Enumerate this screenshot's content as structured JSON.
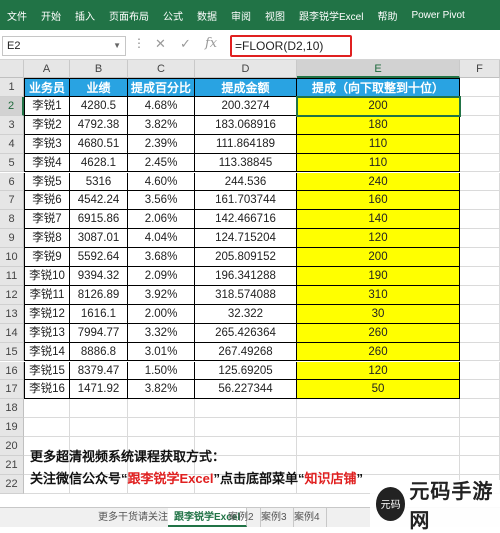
{
  "ribbon": {
    "tabs": [
      "文件",
      "开始",
      "插入",
      "页面布局",
      "公式",
      "数据",
      "审阅",
      "视图",
      "跟李锐学Excel",
      "帮助",
      "Power Pivot"
    ]
  },
  "formula_bar": {
    "name_box": "E2",
    "formula": "=FLOOR(D2,10)",
    "icons": {
      "more": "more-dots-icon",
      "cancel": "cancel-x-icon",
      "enter": "checkmark-icon",
      "fx": "fx-icon"
    }
  },
  "grid": {
    "columns": [
      "A",
      "B",
      "C",
      "D",
      "E",
      "F"
    ],
    "rows": [
      "1",
      "2",
      "3",
      "4",
      "5",
      "6",
      "7",
      "8",
      "9",
      "10",
      "11",
      "12",
      "13",
      "14",
      "15",
      "16",
      "17",
      "18",
      "19",
      "20",
      "21",
      "22"
    ],
    "header": [
      "业务员",
      "业绩",
      "提成百分比",
      "提成金额",
      "提成（向下取整到十位）"
    ],
    "data": [
      [
        "李锐1",
        "4280.5",
        "4.68%",
        "200.3274",
        "200"
      ],
      [
        "李锐2",
        "4792.38",
        "3.82%",
        "183.068916",
        "180"
      ],
      [
        "李锐3",
        "4680.51",
        "2.39%",
        "111.864189",
        "110"
      ],
      [
        "李锐4",
        "4628.1",
        "2.45%",
        "113.38845",
        "110"
      ],
      [
        "李锐5",
        "5316",
        "4.60%",
        "244.536",
        "240"
      ],
      [
        "李锐6",
        "4542.24",
        "3.56%",
        "161.703744",
        "160"
      ],
      [
        "李锐7",
        "6915.86",
        "2.06%",
        "142.466716",
        "140"
      ],
      [
        "李锐8",
        "3087.01",
        "4.04%",
        "124.715204",
        "120"
      ],
      [
        "李锐9",
        "5592.64",
        "3.68%",
        "205.809152",
        "200"
      ],
      [
        "李锐10",
        "9394.32",
        "2.09%",
        "196.341288",
        "190"
      ],
      [
        "李锐11",
        "8126.89",
        "3.92%",
        "318.574088",
        "310"
      ],
      [
        "李锐12",
        "1616.1",
        "2.00%",
        "32.322",
        "30"
      ],
      [
        "李锐13",
        "7994.77",
        "3.32%",
        "265.426364",
        "260"
      ],
      [
        "李锐14",
        "8886.8",
        "3.01%",
        "267.49268",
        "260"
      ],
      [
        "李锐15",
        "8379.47",
        "1.50%",
        "125.69205",
        "120"
      ],
      [
        "李锐16",
        "1471.92",
        "3.82%",
        "56.227344",
        "50"
      ]
    ],
    "note_line1": "更多超清视频系统课程获取方式：",
    "note_line2_prefix": "关注微信公众号“",
    "note_line2_red1": "跟李锐学Excel",
    "note_line2_mid": "”点击底部菜单“",
    "note_line2_red2": "知识店铺",
    "note_line2_suffix": "”"
  },
  "sheet_tabs": [
    "更多干货请关注>>",
    "跟李锐学Excel",
    "案例2",
    "案例3",
    "案例4"
  ],
  "watermark": {
    "text": "元码手游网",
    "logo_text": "元码"
  },
  "colors": {
    "ribbon": "#217346",
    "header_fill": "#29a3e2",
    "result_fill": "#ffff00",
    "highlight": "#e02020"
  }
}
